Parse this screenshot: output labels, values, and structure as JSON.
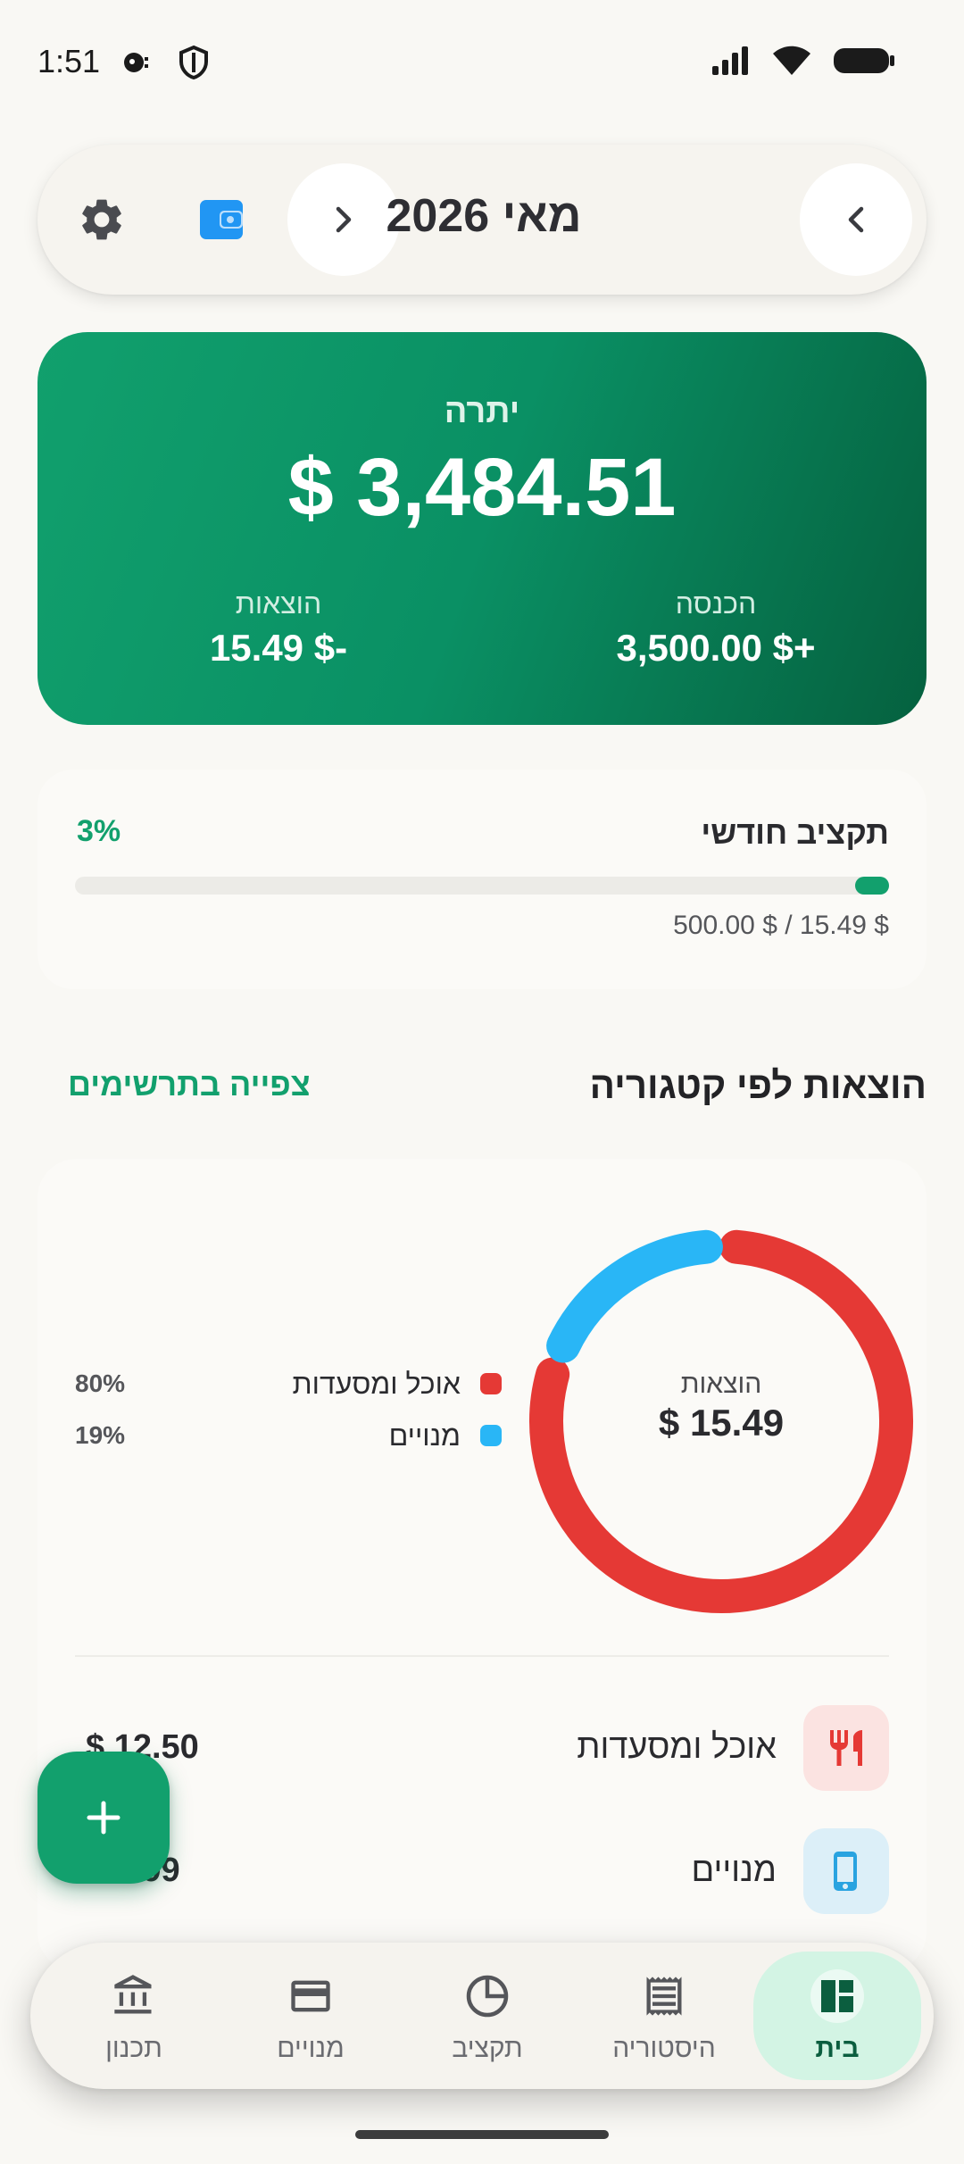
{
  "status_bar": {
    "time": "1:51"
  },
  "header": {
    "month_title": "מאי 2026"
  },
  "balance": {
    "label": "יתרה",
    "value": "$ 3,484.51",
    "income_label": "הכנסה",
    "income_value": "+$ 3,500.00",
    "expense_label": "הוצאות",
    "expense_value": "-$ 15.49"
  },
  "budget": {
    "title": "תקציב חודשי",
    "percent_text": "3%",
    "progress_fraction": 0.031,
    "amounts": "$ 15.49 / $ 500.00"
  },
  "categories_section": {
    "title": "הוצאות לפי קטגוריה",
    "link": "צפייה בתרשימים",
    "donut_label": "הוצאות",
    "donut_value": "$ 15.49",
    "legend": [
      {
        "name": "אוכל ומסעדות",
        "percent": "80%",
        "color": "#E53935",
        "fraction": 0.807
      },
      {
        "name": "מנויים",
        "percent": "19%",
        "color": "#29B6F6",
        "fraction": 0.193
      }
    ],
    "rows": [
      {
        "name": "אוכל ומסעדות",
        "amount": "$ 12.50",
        "icon": "utensils-icon",
        "icon_bg": "#FBE3E1",
        "icon_color": "#E53935"
      },
      {
        "name": "מנויים",
        "amount": "$ 2.99",
        "icon": "phone-icon",
        "icon_bg": "#DCEFF8",
        "icon_color": "#29A3E0"
      }
    ]
  },
  "fab": {
    "icon": "plus-icon"
  },
  "bottom_nav": {
    "items": [
      {
        "label": "בית",
        "icon": "dashboard-icon",
        "active": true
      },
      {
        "label": "היסטוריה",
        "icon": "receipt-icon",
        "active": false
      },
      {
        "label": "תקציב",
        "icon": "pie-icon",
        "active": false
      },
      {
        "label": "מנויים",
        "icon": "card-icon",
        "active": false
      },
      {
        "label": "תכנון",
        "icon": "bank-icon",
        "active": false
      }
    ]
  }
}
